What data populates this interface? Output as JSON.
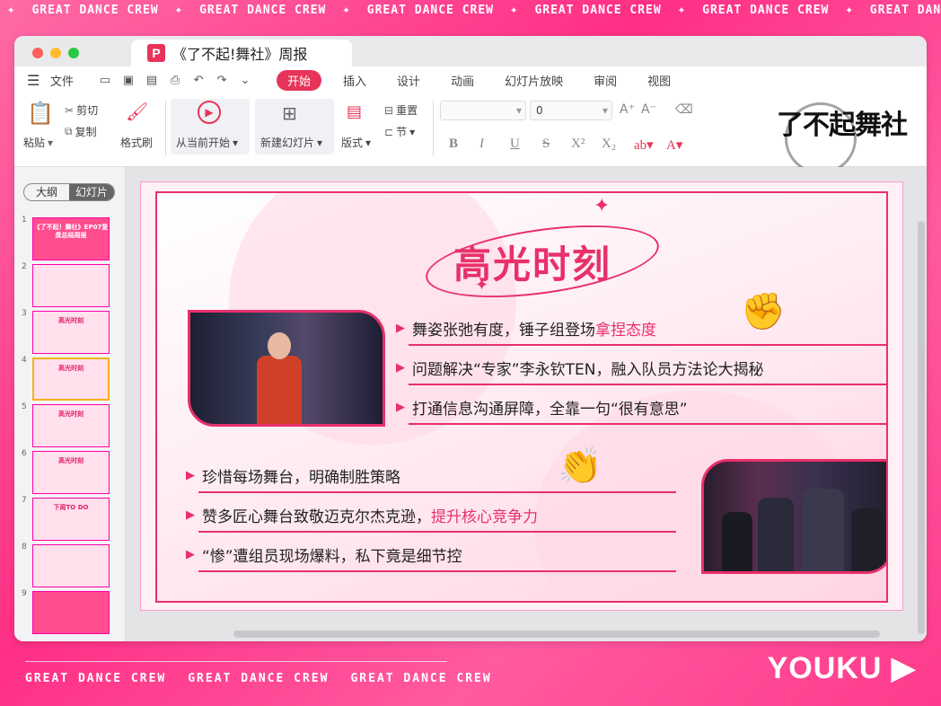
{
  "banner": {
    "top_text": [
      "GREAT DANCE CREW",
      "GREAT DANCE CREW",
      "GREAT DANCE CREW",
      "GREAT DANCE CREW",
      "GREAT DANCE CREW",
      "GREAT DANCE CREW"
    ],
    "bottom_text": [
      "GREAT DANCE CREW",
      "GREAT DANCE CREW",
      "GREAT DANCE CREW"
    ],
    "logo": "YOUKU"
  },
  "window": {
    "tab_title": "《了不起!舞社》周报"
  },
  "menubar": {
    "file": "文件",
    "tabs": [
      "开始",
      "插入",
      "设计",
      "动画",
      "幻灯片放映",
      "审阅",
      "视图"
    ],
    "active_tab": "开始"
  },
  "ribbon": {
    "paste": "粘贴",
    "cut": "剪切",
    "copy": "复制",
    "format_painter": "格式刷",
    "from_current": "从当前开始",
    "new_slide": "新建幻灯片",
    "layout": "版式",
    "reset": "重置",
    "section": "节",
    "font_size": "0",
    "brand": "了不起舞社"
  },
  "sidebar": {
    "outline_tab": "大纲",
    "slides_tab": "幻灯片",
    "thumbnails": [
      {
        "num": "1",
        "text": "《了不起！舞社》EP07复盘总结周报"
      },
      {
        "num": "2",
        "text": ""
      },
      {
        "num": "3",
        "text": "高光时刻"
      },
      {
        "num": "4",
        "text": "高光时刻"
      },
      {
        "num": "5",
        "text": "高光时刻"
      },
      {
        "num": "6",
        "text": "高光时刻"
      },
      {
        "num": "7",
        "text": "下周TO DO"
      },
      {
        "num": "8",
        "text": ""
      },
      {
        "num": "9",
        "text": ""
      }
    ],
    "selected": "4"
  },
  "slide": {
    "title": "高光时刻",
    "bullets_top": [
      {
        "plain": "舞姿张弛有度，锤子组登场",
        "highlight": "拿捏态度"
      },
      {
        "plain": "问题解决“专家”李永钦TEN，融入队员方法论大揭秘",
        "highlight": ""
      },
      {
        "plain": "打通信息沟通屏障，全靠一句“很有意思”",
        "highlight": ""
      }
    ],
    "bullets_bottom": [
      {
        "plain": "珍惜每场舞台，明确制胜策略",
        "highlight": ""
      },
      {
        "plain": "赞多匠心舞台致敬迈克尔杰克逊，",
        "highlight": "提升核心竞争力"
      },
      {
        "plain": "“惨”遭组员现场爆料，私下竟是细节控",
        "highlight": ""
      }
    ]
  },
  "colors": {
    "accent": "#e8306a",
    "highlight": "#e8345a"
  }
}
